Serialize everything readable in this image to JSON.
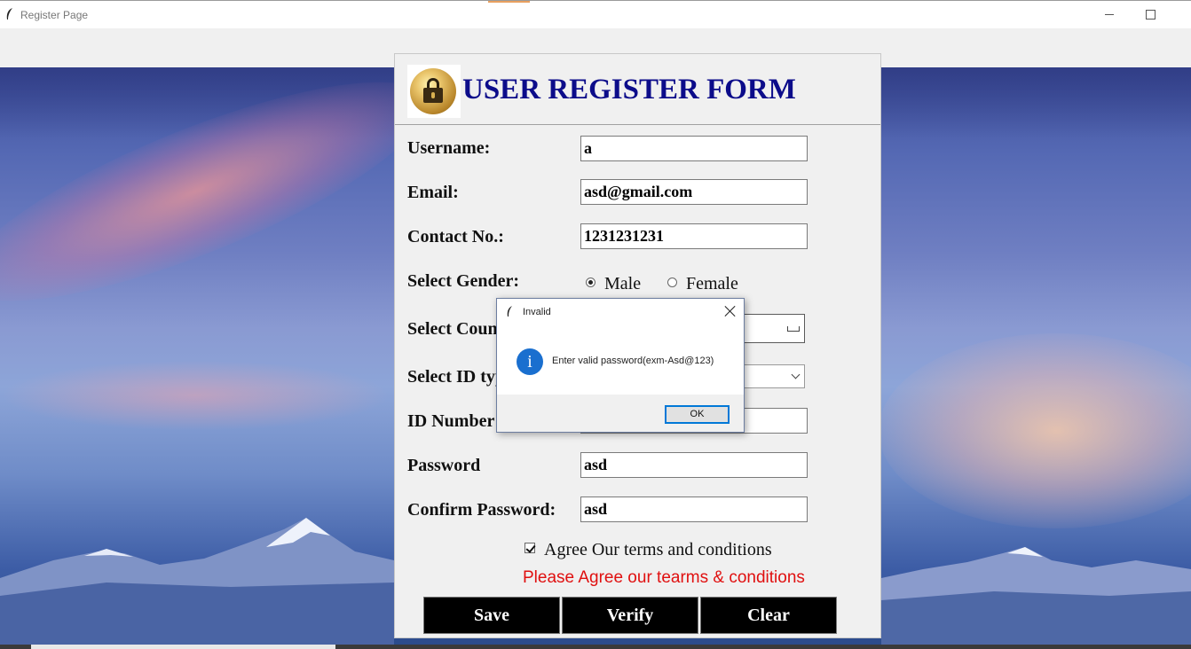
{
  "window": {
    "title": "Register Page"
  },
  "form": {
    "title": "USER REGISTER FORM",
    "fields": {
      "username": {
        "label": "Username:",
        "value": "a"
      },
      "email": {
        "label": "Email:",
        "value": "asd@gmail.com"
      },
      "contact": {
        "label": "Contact No.:",
        "value": "1231231231"
      },
      "gender": {
        "label": "Select Gender:",
        "options": [
          "Male",
          "Female"
        ],
        "selected": "Male"
      },
      "country": {
        "label": "Select Country:"
      },
      "id_type": {
        "label": "Select ID type:"
      },
      "id_number": {
        "label": "ID Number:",
        "value": ""
      },
      "password": {
        "label": "Password",
        "value": "asd"
      },
      "confirm_password": {
        "label": "Confirm Password:",
        "value": "asd"
      }
    },
    "agree": {
      "label": "Agree Our terms and conditions",
      "checked": true
    },
    "warning": "Please Agree our tearms & conditions",
    "buttons": {
      "save": "Save",
      "verify": "Verify",
      "clear": "Clear"
    }
  },
  "dialog": {
    "title": "Invalid",
    "message": "Enter valid password(exm-Asd@123)",
    "ok_label": "OK",
    "icon": "info-icon"
  },
  "colors": {
    "title_blue": "#0c0c8a",
    "warning_red": "#e01010",
    "button_bg": "#000000",
    "dialog_accent": "#0078d7"
  }
}
